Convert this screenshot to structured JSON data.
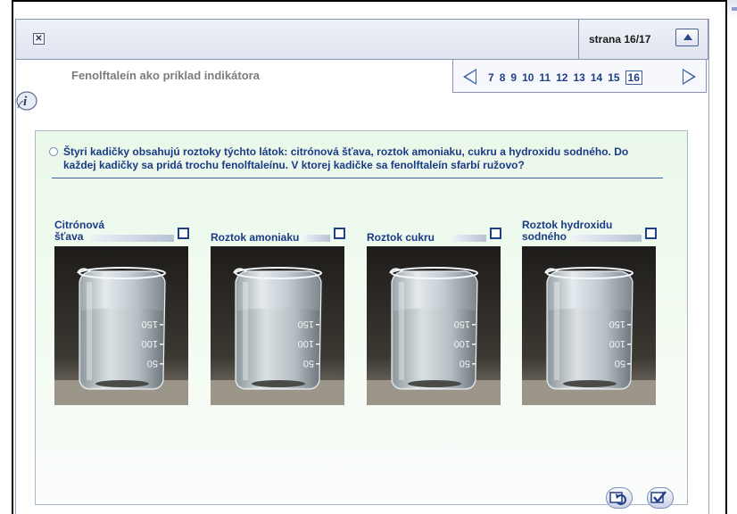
{
  "header": {
    "close_icon": "close-x-icon",
    "page_label": "strana 16/17",
    "up_icon": "triangle-up-icon"
  },
  "title": "Fenolftaleín ako príklad indikátora",
  "nav": {
    "pages": [
      "7",
      "8",
      "9",
      "10",
      "11",
      "12",
      "13",
      "14",
      "15"
    ],
    "current": "16",
    "prev_icon": "arrow-left-icon",
    "next_icon": "arrow-right-icon"
  },
  "info_icon": "info-icon",
  "question": "Štyri kadičky obsahujú roztoky týchto látok: citrónová šťava, roztok amoniaku, cukru a hydroxidu sodného. Do každej kadičky sa pridá trochu fenolftaleínu. V ktorej kadičke sa fenolftaleín sfarbí ružovo?",
  "options": [
    {
      "line1": "Citrónová",
      "line2": "šťava"
    },
    {
      "line1": "",
      "line2": "Roztok amoniaku"
    },
    {
      "line1": "",
      "line2": "Roztok cukru"
    },
    {
      "line1": "Roztok hydroxidu",
      "line2": "sodného"
    }
  ],
  "beaker_markings": [
    "150",
    "100",
    "50"
  ],
  "bottom_buttons": {
    "reset_icon": "reload-icon",
    "check_icon": "checkmark-icon"
  },
  "colors": {
    "accent": "#1f3f86",
    "nav_arrow": "#3a5fa8",
    "panel_border": "#8a93b3",
    "content_bg": "#eaf8ea"
  }
}
